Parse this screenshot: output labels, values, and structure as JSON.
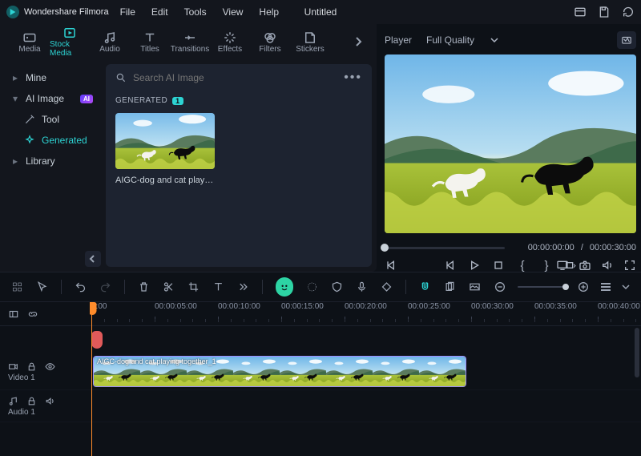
{
  "app": {
    "name": "Wondershare Filmora",
    "title": "Untitled"
  },
  "menu": {
    "file": "File",
    "edit": "Edit",
    "tools": "Tools",
    "view": "View",
    "help": "Help"
  },
  "tabs": {
    "media": "Media",
    "stock": "Stock Media",
    "audio": "Audio",
    "titles": "Titles",
    "transitions": "Transitions",
    "effects": "Effects",
    "filters": "Filters",
    "stickers": "Stickers"
  },
  "sidebar": {
    "mine": "Mine",
    "ai_image": "AI Image",
    "ai_badge": "AI",
    "tool": "Tool",
    "generated": "Generated",
    "library": "Library"
  },
  "search": {
    "placeholder": "Search AI Image"
  },
  "generated": {
    "header": "GENERATED",
    "count": "1",
    "item_label": "AIGC-dog and cat playing t..."
  },
  "player": {
    "label": "Player",
    "quality": "Full Quality",
    "current_time": "00:00:00:00",
    "sep": "/",
    "duration": "00:00:30:00"
  },
  "timeline": {
    "ticks": [
      "0:00",
      "00:00:05:00",
      "00:00:10:00",
      "00:00:15:00",
      "00:00:20:00",
      "00:00:25:00",
      "00:00:30:00",
      "00:00:35:00",
      "00:00:40:00"
    ],
    "tracks": {
      "video1": "Video 1",
      "audio1": "Audio 1"
    },
    "clip_label": "AIGC-dog and cat playing together_1"
  }
}
